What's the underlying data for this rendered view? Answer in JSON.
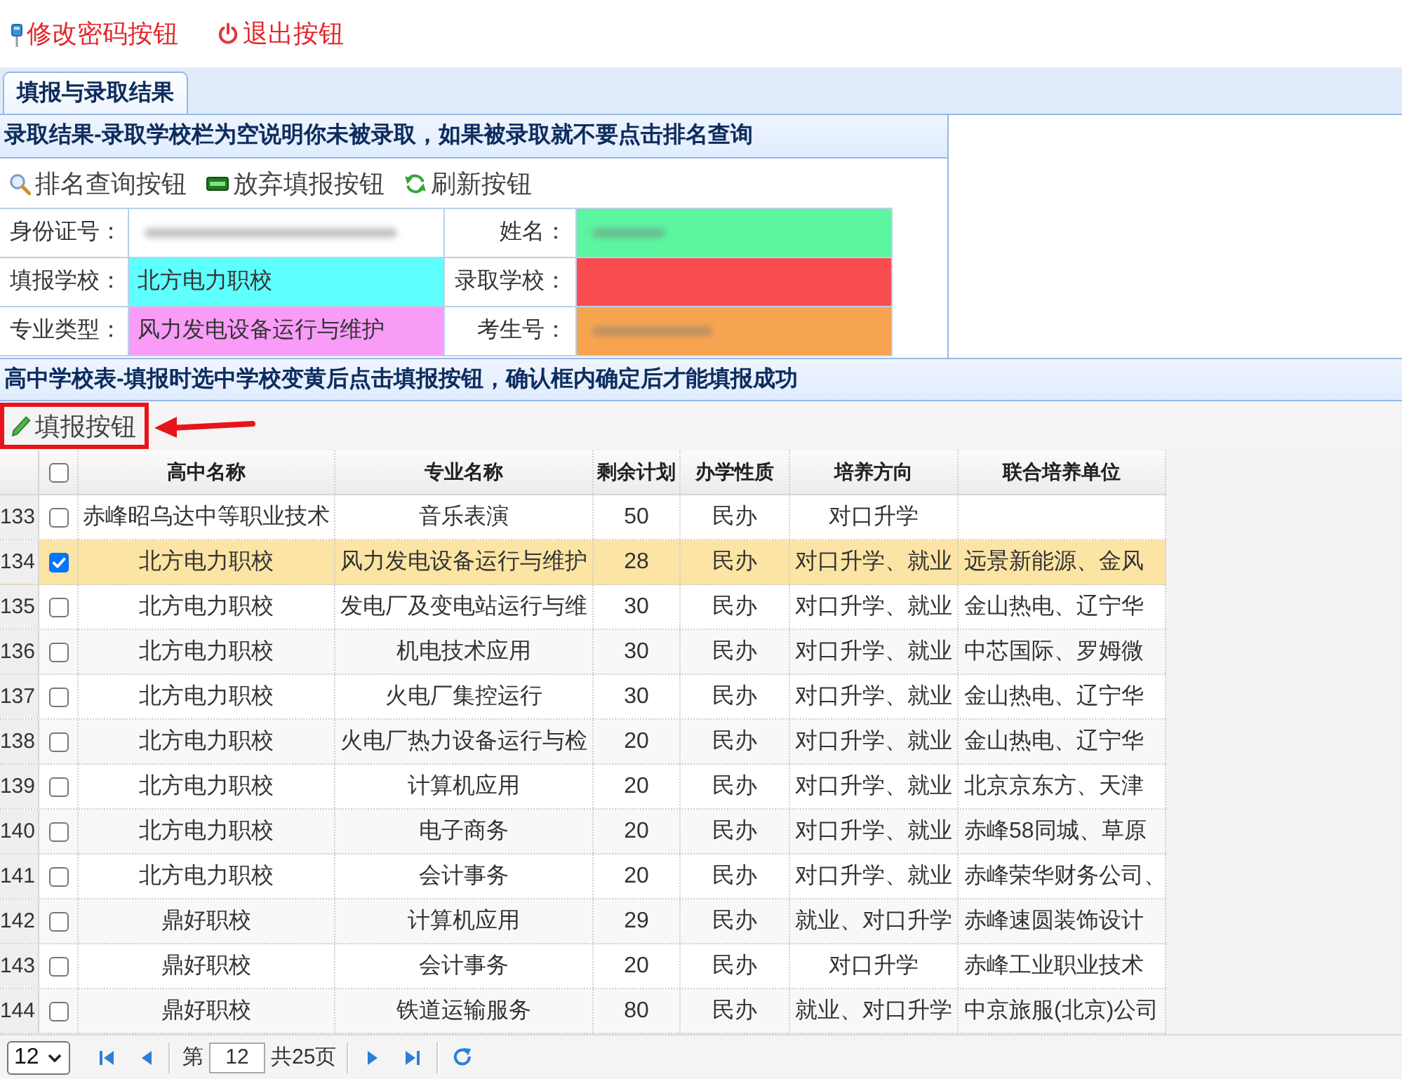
{
  "top_links": [
    {
      "kind": "key",
      "label": "修改密码按钮"
    },
    {
      "kind": "power",
      "label": "退出按钮"
    }
  ],
  "tabs": [
    {
      "label": "填报与录取结果",
      "selected": true
    }
  ],
  "result_panel": {
    "title": "录取结果-录取学校栏为空说明你未被录取，如果被录取就不要点击排名查询",
    "toolbar": [
      {
        "kind": "search",
        "label": "排名查询按钮"
      },
      {
        "kind": "abandon",
        "label": "放弃填报按钮"
      },
      {
        "kind": "refresh",
        "label": "刷新按钮"
      }
    ],
    "fields": [
      {
        "label": "身份证号：",
        "redacted": true,
        "color": "#ffffff"
      },
      {
        "label": "姓名：",
        "redacted": true,
        "color": "#5cf5a0"
      },
      {
        "label": "填报学校：",
        "value": "北方电力职校",
        "redacted": false,
        "color": "#5ffffd"
      },
      {
        "label": "录取学校：",
        "redacted": false,
        "color": "#fa4d50"
      },
      {
        "label": "专业类型：",
        "value": "风力发电设备运行与维护",
        "redacted": false,
        "color": "#f99cf8"
      },
      {
        "label": "考生号：",
        "redacted": true,
        "color": "#f7a450"
      }
    ]
  },
  "school_panel": {
    "title": "高中学校表-填报时选中学校变黄后点击填报按钮，确认框内确定后才能填报成功",
    "toolbar": [
      {
        "kind": "edit",
        "label": "填报按钮",
        "highlighted": true
      }
    ],
    "table": {
      "all_checked": false,
      "columns": [
        "高中名称",
        "专业名称",
        "剩余计划",
        "办学性质",
        "培养方向",
        "联合培养单位"
      ],
      "rows": [
        {
          "number": "133",
          "selected": false,
          "checked": false,
          "cells": [
            "赤峰昭乌达中等职业技术",
            "音乐表演",
            "50",
            "民办",
            "对口升学"
          ]
        },
        {
          "number": "134",
          "selected": true,
          "checked": true,
          "cells": [
            "北方电力职校",
            "风力发电设备运行与维护",
            "28",
            "民办",
            "对口升学、就业",
            "远景新能源、金风"
          ]
        },
        {
          "number": "135",
          "selected": false,
          "checked": false,
          "cells": [
            "北方电力职校",
            "发电厂及变电站运行与维",
            "30",
            "民办",
            "对口升学、就业",
            "金山热电、辽宁华"
          ]
        },
        {
          "number": "136",
          "selected": false,
          "checked": false,
          "cells": [
            "北方电力职校",
            "机电技术应用",
            "30",
            "民办",
            "对口升学、就业",
            "中芯国际、罗姆微"
          ]
        },
        {
          "number": "137",
          "selected": false,
          "checked": false,
          "cells": [
            "北方电力职校",
            "火电厂集控运行",
            "30",
            "民办",
            "对口升学、就业",
            "金山热电、辽宁华"
          ]
        },
        {
          "number": "138",
          "selected": false,
          "checked": false,
          "cells": [
            "北方电力职校",
            "火电厂热力设备运行与检",
            "20",
            "民办",
            "对口升学、就业",
            "金山热电、辽宁华"
          ]
        },
        {
          "number": "139",
          "selected": false,
          "checked": false,
          "cells": [
            "北方电力职校",
            "计算机应用",
            "20",
            "民办",
            "对口升学、就业",
            "北京京东方、天津"
          ]
        },
        {
          "number": "140",
          "selected": false,
          "checked": false,
          "cells": [
            "北方电力职校",
            "电子商务",
            "20",
            "民办",
            "对口升学、就业",
            "赤峰58同城、草原"
          ]
        },
        {
          "number": "141",
          "selected": false,
          "checked": false,
          "cells": [
            "北方电力职校",
            "会计事务",
            "20",
            "民办",
            "对口升学、就业",
            "赤峰荣华财务公司、"
          ]
        },
        {
          "number": "142",
          "selected": false,
          "checked": false,
          "cells": [
            "鼎好职校",
            "计算机应用",
            "29",
            "民办",
            "就业、对口升学",
            "赤峰速圆装饰设计"
          ]
        },
        {
          "number": "143",
          "selected": false,
          "checked": false,
          "cells": [
            "鼎好职校",
            "会计事务",
            "20",
            "民办",
            "对口升学",
            "赤峰工业职业技术"
          ]
        },
        {
          "number": "144",
          "selected": false,
          "checked": false,
          "cells": [
            "鼎好职校",
            "铁道运输服务",
            "80",
            "民办",
            "就业、对口升学",
            "中京旅服(北京)公司"
          ]
        }
      ]
    }
  },
  "pager": {
    "page_size": "12",
    "page_prefix": "第",
    "page": "12",
    "total": "共25页"
  }
}
